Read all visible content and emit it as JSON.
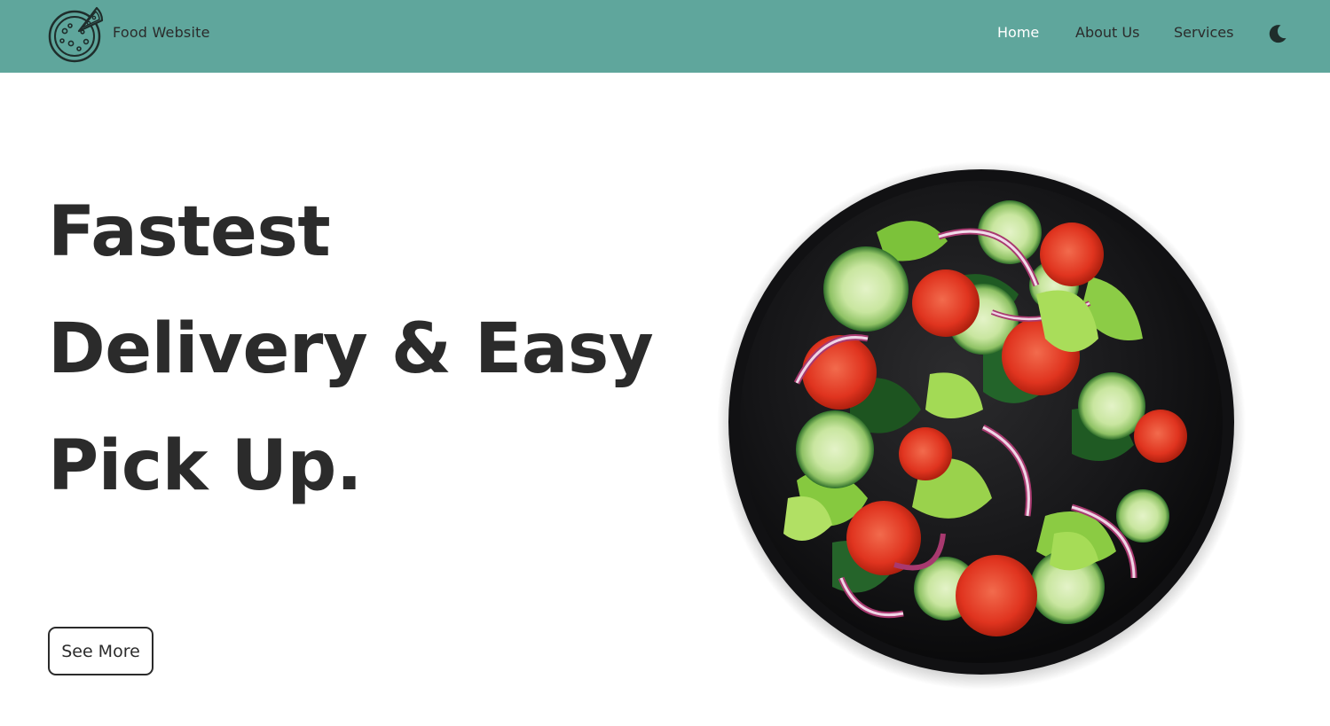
{
  "header": {
    "brand": "Food Website",
    "logo_icon": "pizza-icon",
    "nav": [
      {
        "label": "Home",
        "active": true
      },
      {
        "label": "About Us",
        "active": false
      },
      {
        "label": "Services",
        "active": false
      }
    ],
    "theme_toggle_icon": "moon-icon",
    "background_color": "#5fa69c"
  },
  "hero": {
    "title_lines": [
      "Fastest",
      "Delivery & Easy",
      "Pick Up."
    ],
    "button_label": "See More",
    "image": "salad-bowl"
  },
  "colors": {
    "text": "#2b2b2b",
    "active_nav": "#ffffff",
    "navbar": "#5fa69c"
  }
}
